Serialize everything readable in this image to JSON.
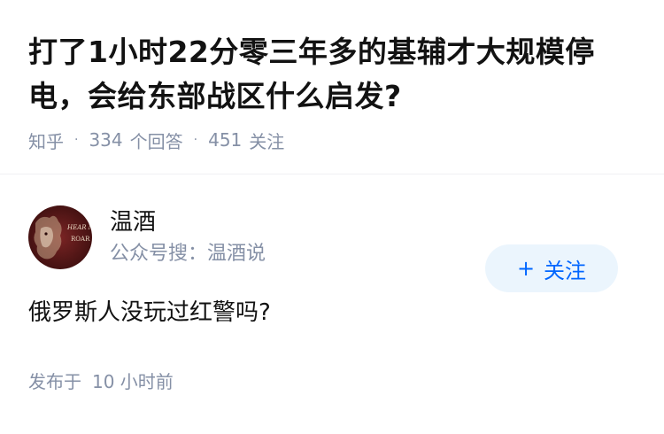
{
  "question": {
    "title": "打了1小时22分零三年多的基辅才大规模停电，会给东部战区什么启发?",
    "meta": {
      "source": "知乎",
      "answers_count": "334",
      "answers_label": "个回答",
      "followers_count": "451",
      "followers_label": "关注"
    }
  },
  "answer": {
    "author": {
      "name": "温酒",
      "bio": "公众号搜：温酒说",
      "avatar_text_line1": "HEAR ME",
      "avatar_text_line2": "ROAR"
    },
    "follow_button": {
      "plus": "+",
      "label": "关注"
    },
    "content": "俄罗斯人没玩过红警吗?",
    "published": {
      "label": "发布于",
      "time": "10 小时前"
    }
  },
  "colors": {
    "primary_text": "#121212",
    "secondary_text": "#8590a6",
    "accent": "#0066ff",
    "button_bg": "#ebf5fd",
    "avatar_bg": "#5a1a1a"
  }
}
